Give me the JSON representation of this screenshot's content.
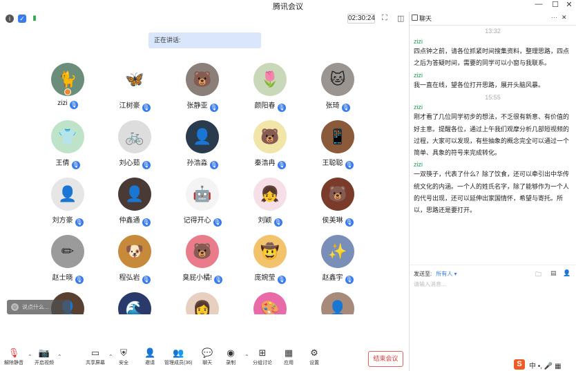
{
  "window": {
    "title": "腾讯会议",
    "min_glyph": "—",
    "max_glyph": "☐",
    "close_glyph": "✕"
  },
  "topbar": {
    "timer": "02:30:24",
    "info_icon": "info-icon",
    "shield_icon": "shield-icon",
    "signal_icon": "signal-icon"
  },
  "speaking": {
    "label": "正在讲话:"
  },
  "participants": [
    {
      "name": "zizi",
      "glyph": "🐈",
      "bg": "#6b8e7a"
    },
    {
      "name": "江树豪",
      "glyph": "🦋",
      "bg": "#ffffff"
    },
    {
      "name": "张静亚",
      "glyph": "🐻",
      "bg": "#8a7f79"
    },
    {
      "name": "颜阳春",
      "glyph": "🌷",
      "bg": "#c9d8b9"
    },
    {
      "name": "张琦",
      "glyph": "🐱",
      "bg": "#9a9590"
    },
    {
      "name": "王倩",
      "glyph": "👕",
      "bg": "#bfe3c8"
    },
    {
      "name": "刘心茹",
      "glyph": "🚲",
      "bg": "#dddddd"
    },
    {
      "name": "孙浩淼",
      "glyph": "👤",
      "bg": "#2b3b4e"
    },
    {
      "name": "秦浩冉",
      "glyph": "🐻",
      "bg": "#f1e5a7"
    },
    {
      "name": "王聪聪",
      "glyph": "📱",
      "bg": "#8a5a3a"
    },
    {
      "name": "刘方豪",
      "glyph": "👤",
      "bg": "#e6e6e6"
    },
    {
      "name": "仲鑫通",
      "glyph": "👤",
      "bg": "#4a3a35"
    },
    {
      "name": "记得开心",
      "glyph": "🤖",
      "bg": "#f4f4f4"
    },
    {
      "name": "刘颖",
      "glyph": "👧",
      "bg": "#f7dfe8"
    },
    {
      "name": "侯美琳",
      "glyph": "🐻",
      "bg": "#7b3b2b"
    },
    {
      "name": "赵士晓",
      "glyph": "✏",
      "bg": "#9b9b9b"
    },
    {
      "name": "程弘岩",
      "glyph": "🐶",
      "bg": "#c68a3a"
    },
    {
      "name": "臭屁小橘!",
      "glyph": "🐻",
      "bg": "#e97b8a"
    },
    {
      "name": "庞婉莹",
      "glyph": "🤠",
      "bg": "#f3c36b"
    },
    {
      "name": "赵鑫宇",
      "glyph": "✨",
      "bg": "#7a8fb8"
    },
    {
      "name": "",
      "glyph": "👤",
      "bg": "#5a4030"
    },
    {
      "name": "",
      "glyph": "🌊",
      "bg": "#2a3b6b"
    },
    {
      "name": "",
      "glyph": "👩",
      "bg": "#e8d0c0"
    },
    {
      "name": "",
      "glyph": "🎨",
      "bg": "#e96aa8"
    },
    {
      "name": "",
      "glyph": "👤",
      "bg": "#a88a7a"
    }
  ],
  "comment_box": {
    "placeholder": "说点什么..."
  },
  "toolbar": {
    "unmute": "解除静音",
    "video": "开启视频",
    "share": "共享屏幕",
    "security": "安全",
    "invite": "邀请",
    "members": "管理成员(36)",
    "chat": "聊天",
    "record": "录制",
    "breakout": "分组讨论",
    "apps": "应用",
    "settings": "设置",
    "end": "结束会议"
  },
  "chat": {
    "title": "聊天",
    "more": "···",
    "close": "✕",
    "time1": "13:32",
    "time2": "15:55",
    "messages": [
      {
        "sender": "zizi",
        "lines": [
          "四点钟之前，请各位抓紧时间搜集资料，整理思路，四点",
          "之后为答疑时间，需要的同学可以小窗与我联系。"
        ]
      },
      {
        "sender": "zizi",
        "lines": [
          "我一直在线，望各位打开思路，展开头脑风暴。"
        ]
      },
      {
        "sender": "zizi",
        "lines": [
          "刚才看了几位同学初步的想法，不乏很有新意、有价值的",
          "好主意。提醒各位，通过上午我们观摩分析几部短视频的",
          "过程，大家可以发现，有些抽象的概念完全可以通过一个",
          "简单、具象的符号来完成转化。"
        ]
      },
      {
        "sender": "zizi",
        "lines": [
          "一双筷子，代表了什么？除了饮食，还可以牵引出中华传",
          "统文化的内涵。一个人的姓氏名字，除了能够作为一个人",
          "的代号出现，还可以延伸出家国情怀，希望与寄托。所",
          "以，思路还是要打开。"
        ]
      }
    ],
    "send_to_label": "发送至:",
    "send_to_value": "所有人",
    "input_placeholder": "请输入消息..."
  },
  "ime": {
    "text": "中 •, 🎤 ▦"
  }
}
